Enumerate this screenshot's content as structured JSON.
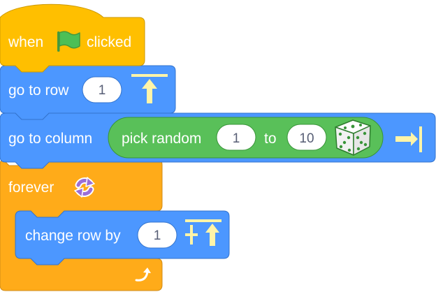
{
  "script": {
    "hat_block": {
      "label_before": "when",
      "icon": "green-flag-icon",
      "label_after": "clicked",
      "color": "#ffbf00"
    },
    "go_to_row": {
      "label": "go to row",
      "value": "1",
      "icon": "arrow-up-to-bar-icon",
      "color": "#4c97ff"
    },
    "go_to_column": {
      "label": "go to column",
      "icon": "arrow-right-to-bar-icon",
      "color": "#4c97ff",
      "pick_random": {
        "label": "pick random",
        "from": "1",
        "joiner": "to",
        "to": "10",
        "icon": "dice-icon",
        "color": "#59c059"
      }
    },
    "forever": {
      "label": "forever",
      "icon": "repeat-arrows-icon",
      "loop_end_icon": "loop-arrow-icon",
      "color": "#ffab19"
    },
    "change_row": {
      "label": "change row by",
      "value": "1",
      "icon": "plus-arrow-up-icon",
      "color": "#4c97ff"
    }
  }
}
